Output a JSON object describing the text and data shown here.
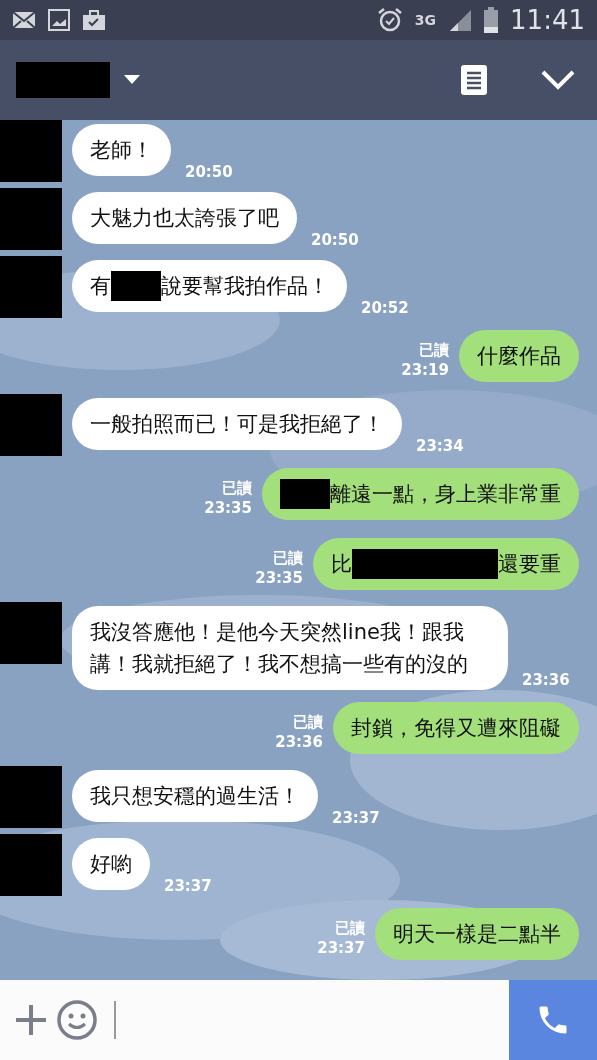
{
  "status_bar": {
    "network": "3G",
    "time": "11:41"
  },
  "messages": [
    {
      "kind": "incoming",
      "parts": [
        {
          "kind": "text",
          "text": "老師！"
        }
      ],
      "time": "20:50"
    },
    {
      "kind": "incoming",
      "parts": [
        {
          "kind": "text",
          "text": "大魅力也太誇張了吧"
        }
      ],
      "time": "20:50"
    },
    {
      "kind": "incoming",
      "parts": [
        {
          "kind": "text",
          "text": "有"
        },
        {
          "kind": "redacted"
        },
        {
          "kind": "text",
          "text": "說要幫我拍作品！"
        }
      ],
      "time": "20:52"
    },
    {
      "kind": "outgoing",
      "read": "已讀",
      "parts": [
        {
          "kind": "text",
          "text": "什麼作品"
        }
      ],
      "time": "23:19"
    },
    {
      "kind": "incoming",
      "parts": [
        {
          "kind": "text",
          "text": "一般拍照而已！可是我拒絕了！"
        }
      ],
      "time": "23:34"
    },
    {
      "kind": "outgoing",
      "read": "已讀",
      "parts": [
        {
          "kind": "redacted"
        },
        {
          "kind": "text",
          "text": "離遠一點，身上業非常重"
        }
      ],
      "time": "23:35"
    },
    {
      "kind": "outgoing",
      "read": "已讀",
      "parts": [
        {
          "kind": "text",
          "text": "比"
        },
        {
          "kind": "redacted_wide"
        },
        {
          "kind": "text",
          "text": "還要重"
        }
      ],
      "time": "23:35"
    },
    {
      "kind": "incoming",
      "parts": [
        {
          "kind": "text",
          "text": "我沒答應他！是他今天突然line我！跟我講！我就拒絕了！我不想搞一些有的沒的"
        }
      ],
      "time": "23:36"
    },
    {
      "kind": "outgoing",
      "read": "已讀",
      "parts": [
        {
          "kind": "text",
          "text": "封鎖，免得又遭來阻礙"
        }
      ],
      "time": "23:36"
    },
    {
      "kind": "incoming",
      "parts": [
        {
          "kind": "text",
          "text": "我只想安穩的過生活！"
        }
      ],
      "time": "23:37"
    },
    {
      "kind": "incoming",
      "parts": [
        {
          "kind": "text",
          "text": "好喲"
        }
      ],
      "time": "23:37"
    },
    {
      "kind": "outgoing",
      "read": "已讀",
      "parts": [
        {
          "kind": "text",
          "text": "明天一樣是二點半"
        }
      ],
      "time": "23:37"
    }
  ]
}
